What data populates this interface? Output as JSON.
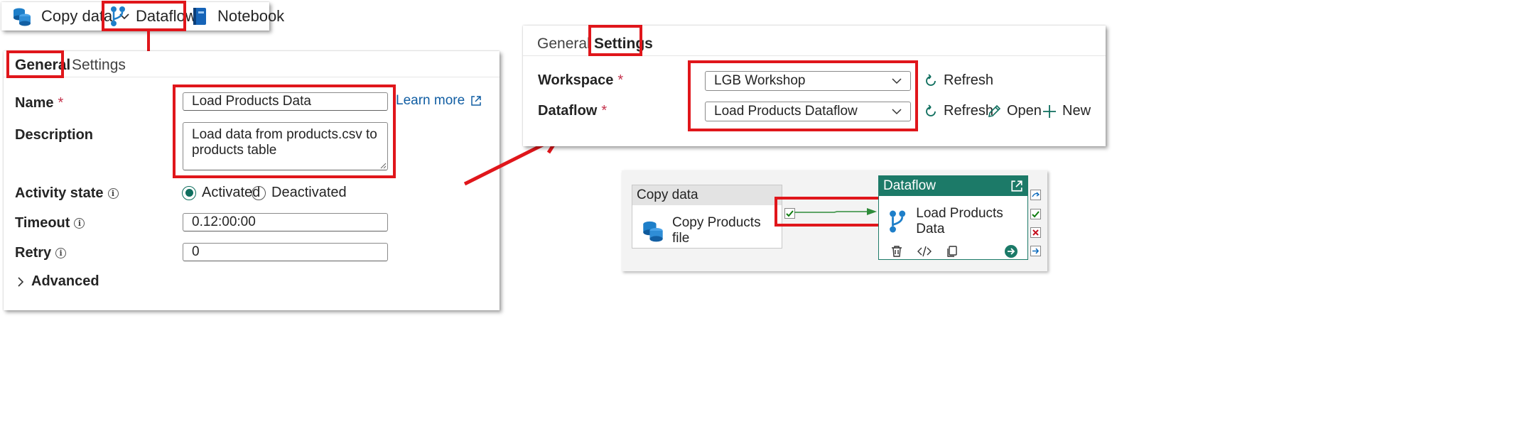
{
  "toolbar": {
    "copy_data": "Copy data",
    "dataflow": "Dataflow",
    "notebook": "Notebook"
  },
  "left_panel": {
    "tabs": [
      "General",
      "Settings"
    ],
    "name_label": "Name",
    "required_mark": "*",
    "name_value": "Load Products Data",
    "learn_more": "Learn more",
    "description_label": "Description",
    "description_value": "Load data from products.csv to products table",
    "activity_state_label": "Activity state",
    "activated": "Activated",
    "deactivated": "Deactivated",
    "activity_state_selected": "Activated",
    "timeout_label": "Timeout",
    "timeout_value": "0.12:00:00",
    "retry_label": "Retry",
    "retry_value": "0",
    "advanced_label": "Advanced"
  },
  "right_panel": {
    "tabs": [
      "General",
      "Settings"
    ],
    "workspace_label": "Workspace",
    "workspace_value": "LGB Workshop",
    "dataflow_label": "Dataflow",
    "dataflow_value": "Load Products Dataflow",
    "refresh": "Refresh",
    "open": "Open",
    "new": "New"
  },
  "canvas": {
    "copy_node_header": "Copy data",
    "copy_node_name": "Copy Products file",
    "dataflow_node_header": "Dataflow",
    "dataflow_node_name": "Load Products Data"
  },
  "colors": {
    "highlight_red": "#e0161b",
    "dataflow_header": "#1c7a68",
    "success_green": "#107c10",
    "fail_red": "#c50f1f",
    "accent_blue": "#0f6cbd"
  }
}
